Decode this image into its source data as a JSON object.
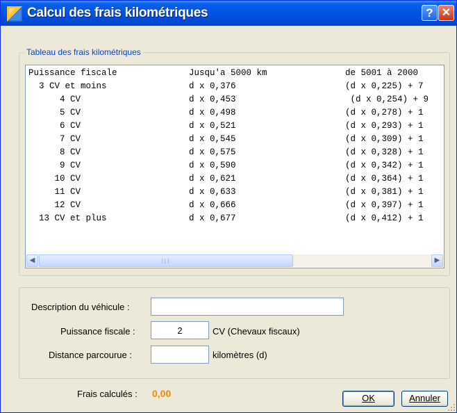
{
  "window": {
    "title": "Calcul des frais kilométriques",
    "help_label": "?",
    "close_label": "✕",
    "title_color": "#0054e3"
  },
  "table_group": {
    "legend": "Tableau des frais kilométriques",
    "header": [
      "Puissance fiscale",
      "Jusqu'a 5000 km",
      "de 5001 à 2000"
    ],
    "rows": [
      [
        "  3 CV et moins",
        "d x 0,376",
        "(d x 0,225) + 7"
      ],
      [
        "      4 CV",
        "d x 0,453",
        " (d x 0,254) + 9"
      ],
      [
        "      5 CV",
        "d x 0,498",
        "(d x 0,278) + 1"
      ],
      [
        "      6 CV",
        "d x 0,521",
        "(d x 0,293) + 1"
      ],
      [
        "      7 CV",
        "d x 0,545",
        "(d x 0,309) + 1"
      ],
      [
        "      8 CV",
        "d x 0,575",
        "(d x 0,328) + 1"
      ],
      [
        "      9 CV",
        "d x 0,590",
        "(d x 0,342) + 1"
      ],
      [
        "     10 CV",
        "d x 0,621",
        "(d x 0,364) + 1"
      ],
      [
        "     11 CV",
        "d x 0,633",
        "(d x 0,381) + 1"
      ],
      [
        "     12 CV",
        "d x 0,666",
        "(d x 0,397) + 1"
      ],
      [
        "  13 CV et plus",
        "d x 0,677",
        "(d x 0,412) + 1"
      ]
    ],
    "scroll_left_icon": "left-arrow-icon",
    "scroll_right_icon": "right-arrow-icon"
  },
  "form": {
    "description_label": "Description du véhicule :",
    "description_value": "",
    "puissance_label": "Puissance fiscale :",
    "puissance_value": "2",
    "puissance_unit": "CV (Chevaux fiscaux)",
    "distance_label": "Distance parcourue :",
    "distance_value": "",
    "distance_unit": "kilomètres (d)"
  },
  "result": {
    "label": "Frais calculés :",
    "value": "0,00",
    "value_color": "#e98a1b"
  },
  "buttons": {
    "ok": "OK",
    "cancel": "Annuler"
  }
}
